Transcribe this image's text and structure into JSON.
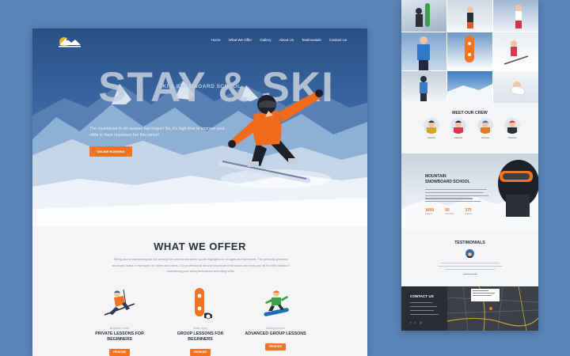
{
  "nav": {
    "logo_text": "MOUNTAIN",
    "links": [
      "Home",
      "What We Offer",
      "Gallery",
      "About Us",
      "Testimonials",
      "Contact Us"
    ]
  },
  "hero": {
    "subtitle": "SKI & SNOWBOARD SCHOOL",
    "title": "STAY & SKI",
    "text": "The countdown to ski season has begun! So, it's high time to improve your skills to have maximum fun this winter!",
    "button": "ONLINE BOOKING"
  },
  "offer": {
    "title": "WHAT WE OFFER",
    "description": "Skiing and snowboarding are fun among the commonest winter sports highlights for all ages and skill levels. The perfectly groomed ski slopes make a real haven for skiers and riders. Our professional ski and snowboard instructors can show you all the little details of maintaining your skiing techniques and riding skills.",
    "cards": [
      {
        "level": "Beginner's level",
        "name": "PRIVATE LESSONS FOR BEGINNERS",
        "button": "FROM $50"
      },
      {
        "level": "Basic level",
        "name": "GROUP LESSONS FOR BEGINNERS",
        "button": "FROM $40"
      },
      {
        "level": "Advanced level",
        "name": "ADVANCED GROUP LESSONS",
        "button": "FROM $70"
      }
    ]
  },
  "crew": {
    "title": "MEET OUR CREW",
    "members": [
      "Instructor",
      "Instructor",
      "Instructor",
      "Instructor"
    ]
  },
  "school": {
    "title_line1": "MOUNTAIN",
    "title_line2": "SNOWBOARD SCHOOL",
    "stats": [
      {
        "value": "1600",
        "label": "Students"
      },
      {
        "value": "50",
        "label": "Instructors"
      },
      {
        "value": "375",
        "label": "Lessons"
      }
    ]
  },
  "testimonials": {
    "title": "TESTIMONIALS"
  },
  "contact": {
    "title": "CONTACT US",
    "social": [
      "f",
      "t",
      "◎"
    ]
  },
  "colors": {
    "accent": "#f47321",
    "background": "#5a84b8",
    "dark": "#2a2d33"
  }
}
